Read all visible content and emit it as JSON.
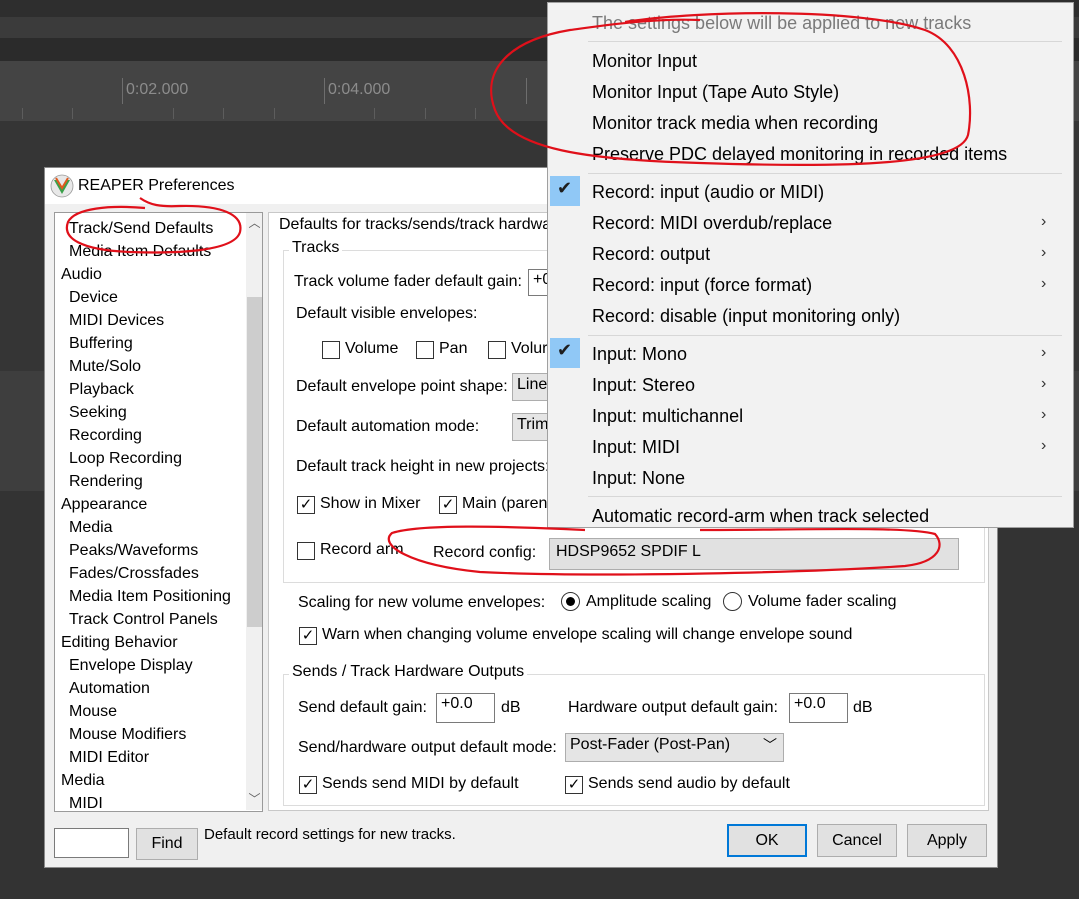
{
  "timeline": {
    "labels": [
      "0:02.000",
      "0:04.000"
    ]
  },
  "dialog": {
    "title": "REAPER Preferences",
    "tree": {
      "items": [
        {
          "label": "Track/Send Defaults",
          "level": 1
        },
        {
          "label": "Media Item Defaults",
          "level": 1
        },
        {
          "label": "Audio",
          "level": 0
        },
        {
          "label": "Device",
          "level": 1
        },
        {
          "label": "MIDI Devices",
          "level": 1
        },
        {
          "label": "Buffering",
          "level": 1
        },
        {
          "label": "Mute/Solo",
          "level": 1
        },
        {
          "label": "Playback",
          "level": 1
        },
        {
          "label": "Seeking",
          "level": 1
        },
        {
          "label": "Recording",
          "level": 1
        },
        {
          "label": "Loop Recording",
          "level": 1
        },
        {
          "label": "Rendering",
          "level": 1
        },
        {
          "label": "Appearance",
          "level": 0
        },
        {
          "label": "Media",
          "level": 1
        },
        {
          "label": "Peaks/Waveforms",
          "level": 1
        },
        {
          "label": "Fades/Crossfades",
          "level": 1
        },
        {
          "label": "Media Item Positioning",
          "level": 1
        },
        {
          "label": "Track Control Panels",
          "level": 1
        },
        {
          "label": "Editing Behavior",
          "level": 0
        },
        {
          "label": "Envelope Display",
          "level": 1
        },
        {
          "label": "Automation",
          "level": 1
        },
        {
          "label": "Mouse",
          "level": 1
        },
        {
          "label": "Mouse Modifiers",
          "level": 1
        },
        {
          "label": "MIDI Editor",
          "level": 1
        },
        {
          "label": "Media",
          "level": 0
        },
        {
          "label": "MIDI",
          "level": 1
        }
      ]
    },
    "panel": {
      "heading": "Defaults for tracks/sends/track hardwa",
      "tracks_group": "Tracks",
      "fader_gain_label": "Track volume fader default gain:",
      "fader_gain_value": "+0",
      "visible_env_label": "Default visible envelopes:",
      "env_volume": "Volume",
      "env_pan": "Pan",
      "env_volume2": "Volur",
      "env_point_label": "Default envelope point shape:",
      "env_point_value": "Linea",
      "automation_label": "Default automation mode:",
      "automation_value": "Trim/",
      "height_label": "Default track height in new projects:",
      "show_mixer": "Show in Mixer",
      "main_parent": "Main (parent",
      "record_arm": "Record arm",
      "record_config_label": "Record config:",
      "record_config_value": "HDSP9652 SPDIF L",
      "scaling_label": "Scaling for new volume envelopes:",
      "amp_scaling": "Amplitude scaling",
      "fader_scaling": "Volume fader scaling",
      "warn_scaling": "Warn when changing volume envelope scaling will change envelope sound",
      "sends_group": "Sends / Track Hardware Outputs",
      "send_gain_label": "Send default gain:",
      "send_gain_value": "+0.0",
      "db1": "dB",
      "hw_gain_label": "Hardware output default gain:",
      "hw_gain_value": "+0.0",
      "db2": "dB",
      "send_mode_label": "Send/hardware output default mode:",
      "send_mode_value": "Post-Fader (Post-Pan)",
      "sends_midi": "Sends send MIDI by default",
      "sends_audio": "Sends send audio by default"
    },
    "footer": {
      "find_value": "",
      "find_label": "Find",
      "status": "Default record settings for new tracks.",
      "ok": "OK",
      "cancel": "Cancel",
      "apply": "Apply"
    }
  },
  "menu": {
    "header": "The settings below will be applied to new tracks",
    "items": [
      {
        "label": "Monitor Input",
        "checked": false,
        "submenu": false
      },
      {
        "label": "Monitor Input (Tape Auto Style)",
        "checked": false,
        "submenu": false
      },
      {
        "label": "Monitor track media when recording",
        "checked": false,
        "submenu": false
      },
      {
        "label": "Preserve PDC delayed monitoring in recorded items",
        "checked": false,
        "submenu": false
      },
      {
        "label": "Record: input (audio or MIDI)",
        "checked": true,
        "submenu": false
      },
      {
        "label": "Record: MIDI overdub/replace",
        "checked": false,
        "submenu": true
      },
      {
        "label": "Record: output",
        "checked": false,
        "submenu": true
      },
      {
        "label": "Record: input (force format)",
        "checked": false,
        "submenu": true
      },
      {
        "label": "Record: disable (input monitoring only)",
        "checked": false,
        "submenu": false
      },
      {
        "label": "Input: Mono",
        "checked": true,
        "submenu": true
      },
      {
        "label": "Input: Stereo",
        "checked": false,
        "submenu": true
      },
      {
        "label": "Input: multichannel",
        "checked": false,
        "submenu": true
      },
      {
        "label": "Input: MIDI",
        "checked": false,
        "submenu": true
      },
      {
        "label": "Input: None",
        "checked": false,
        "submenu": false
      },
      {
        "label": "Automatic record-arm when track selected",
        "checked": false,
        "submenu": false
      }
    ]
  },
  "colors": {
    "annotation": "#e0101a",
    "check_highlight": "#90c8f6",
    "primary_button_border": "#0078d7"
  }
}
